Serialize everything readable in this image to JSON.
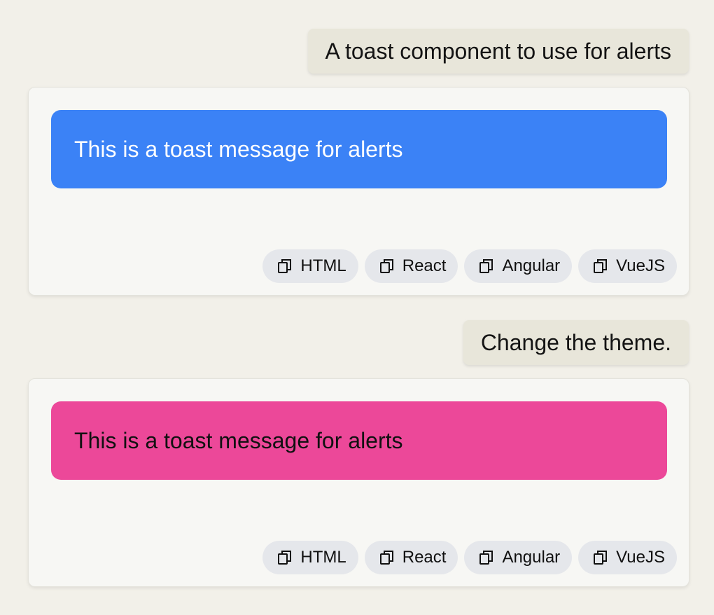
{
  "conversation": [
    {
      "user_message": "A toast component to use for alerts",
      "response": {
        "toast_text": "This is a toast message for alerts",
        "toast_color": "#3b82f6",
        "toast_text_color": "#ffffff",
        "buttons": [
          "HTML",
          "React",
          "Angular",
          "VueJS"
        ]
      }
    },
    {
      "user_message": "Change the theme.",
      "response": {
        "toast_text": "This is a toast message for alerts",
        "toast_color": "#ec4899",
        "toast_text_color": "#111111",
        "buttons": [
          "HTML",
          "React",
          "Angular",
          "VueJS"
        ]
      }
    }
  ],
  "icons": {
    "copy": "copy-icon"
  }
}
